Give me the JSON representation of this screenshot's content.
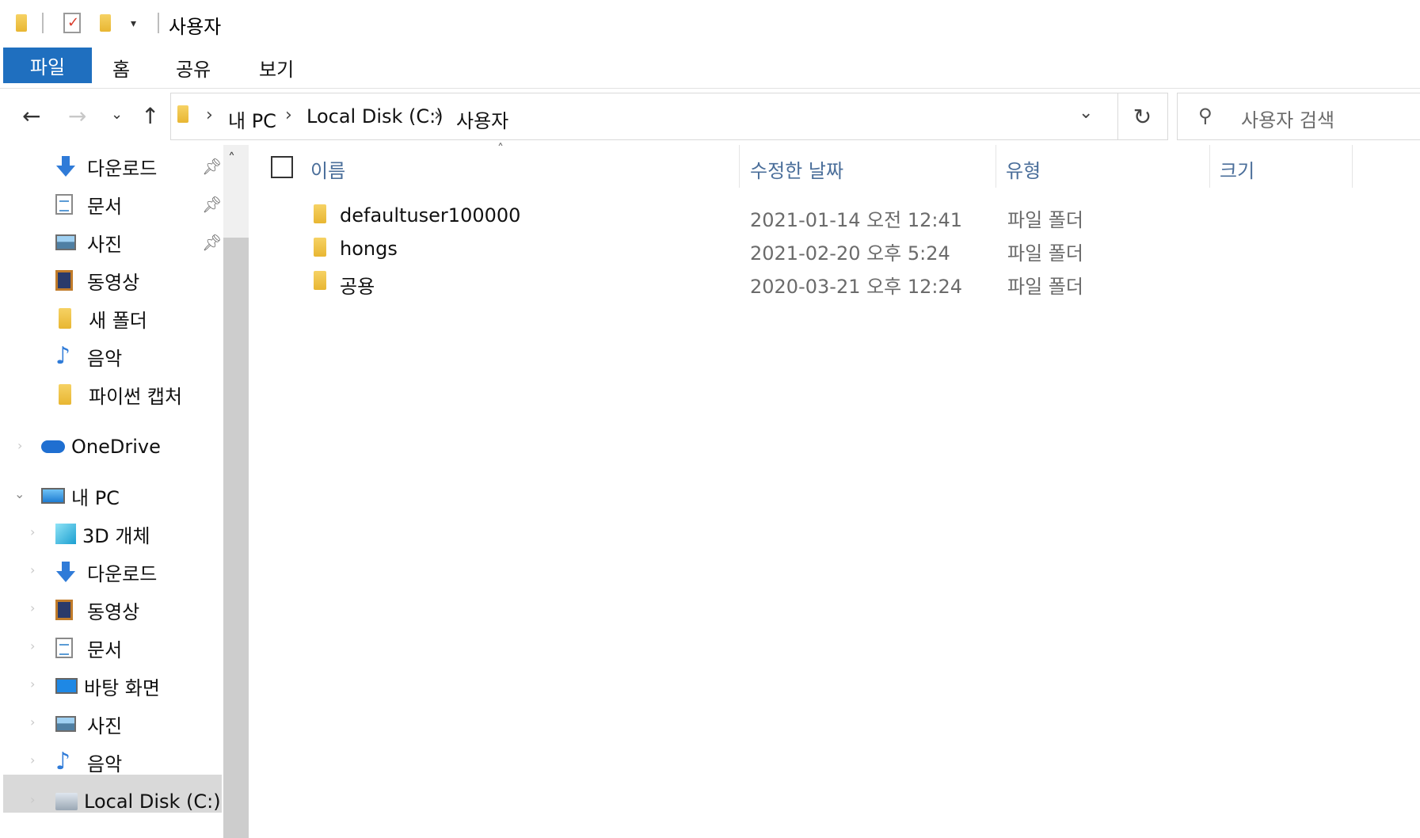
{
  "window": {
    "title": "사용자"
  },
  "ribbon": {
    "tabs": [
      "파일",
      "홈",
      "공유",
      "보기"
    ]
  },
  "address_bar": {
    "breadcrumbs": [
      "내 PC",
      "Local Disk (C:)",
      "사용자"
    ]
  },
  "search": {
    "placeholder": "사용자 검색"
  },
  "sidebar": {
    "quick_access": [
      {
        "label": "다운로드",
        "icon": "download-icon",
        "pinned": true
      },
      {
        "label": "문서",
        "icon": "document-icon",
        "pinned": true
      },
      {
        "label": "사진",
        "icon": "picture-icon",
        "pinned": true
      },
      {
        "label": "동영상",
        "icon": "video-icon",
        "pinned": false
      },
      {
        "label": "새 폴더",
        "icon": "folder-icon",
        "pinned": false
      },
      {
        "label": "음악",
        "icon": "music-icon",
        "pinned": false
      },
      {
        "label": "파이썬 캡처",
        "icon": "folder-icon",
        "pinned": false
      }
    ],
    "onedrive": {
      "label": "OneDrive",
      "icon": "onedrive-icon"
    },
    "this_pc": {
      "label": "내 PC",
      "icon": "pc-icon",
      "children": [
        {
          "label": "3D 개체",
          "icon": "3d-objects-icon"
        },
        {
          "label": "다운로드",
          "icon": "download-icon"
        },
        {
          "label": "동영상",
          "icon": "video-icon"
        },
        {
          "label": "문서",
          "icon": "document-icon"
        },
        {
          "label": "바탕 화면",
          "icon": "desktop-icon"
        },
        {
          "label": "사진",
          "icon": "picture-icon"
        },
        {
          "label": "음악",
          "icon": "music-icon"
        },
        {
          "label": "Local Disk (C:)",
          "icon": "disk-icon",
          "selected": true
        }
      ]
    }
  },
  "content": {
    "columns": [
      "이름",
      "수정한 날짜",
      "유형",
      "크기"
    ],
    "files": [
      {
        "name": "defaultuser100000",
        "date": "2021-01-14 오전 12:41",
        "type": "파일 폴더"
      },
      {
        "name": "hongs",
        "date": "2021-02-20 오후 5:24",
        "type": "파일 폴더"
      },
      {
        "name": "공용",
        "date": "2020-03-21 오후 12:24",
        "type": "파일 폴더"
      }
    ]
  },
  "colors": {
    "file_tab": "#1f6fbf",
    "column_header": "#4a6e9a",
    "folder": "#f0c44c"
  }
}
